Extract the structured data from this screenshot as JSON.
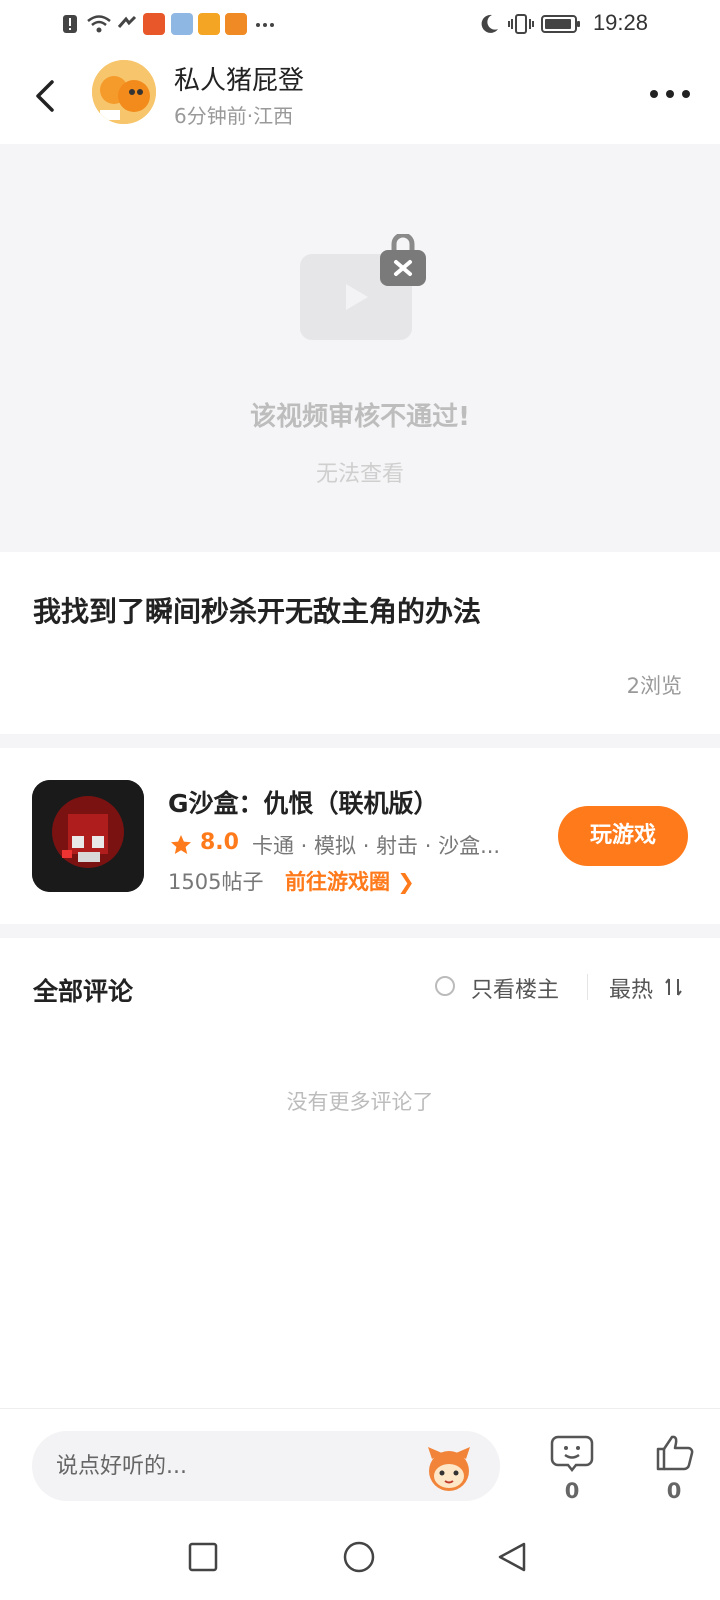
{
  "status_bar": {
    "time": "19:28",
    "left_icons": [
      "alert-icon",
      "wifi-icon",
      "data-icon",
      "app-icon",
      "app-icon",
      "app-icon",
      "app-icon",
      "more-dots-icon"
    ],
    "right_icons": [
      "moon-icon",
      "vibrate-icon",
      "battery-icon"
    ]
  },
  "header": {
    "author_name": "私人猪屁登",
    "author_meta": "6分钟前·江西"
  },
  "video": {
    "blocked_title": "该视频审核不通过!",
    "blocked_subtitle": "无法查看"
  },
  "post": {
    "title": "我找到了瞬间秒杀开无敌主角的办法",
    "views": "2浏览"
  },
  "game": {
    "name": "G沙盒：仇恨（联机版）",
    "score": "8.0",
    "tags": "卡通 · 模拟 · 射击 · 沙盒...",
    "posts": "1505帖子",
    "circle_link": "前往游戏圈 ❯",
    "play_label": "玩游戏",
    "accent_color": "#ff7a1a"
  },
  "comments": {
    "title": "全部评论",
    "op_only": "只看楼主",
    "sort": "最热",
    "empty_text": "没有更多评论了"
  },
  "bottom_bar": {
    "input_placeholder": "说点好听的...",
    "comment_count": "0",
    "like_count": "0"
  }
}
